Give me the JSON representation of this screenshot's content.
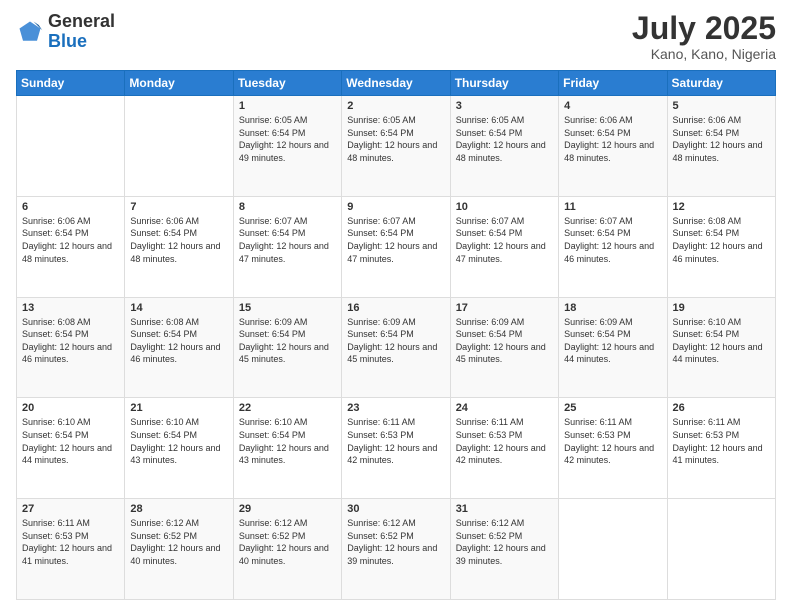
{
  "header": {
    "logo_general": "General",
    "logo_blue": "Blue",
    "month": "July 2025",
    "location": "Kano, Kano, Nigeria"
  },
  "weekdays": [
    "Sunday",
    "Monday",
    "Tuesday",
    "Wednesday",
    "Thursday",
    "Friday",
    "Saturday"
  ],
  "weeks": [
    [
      {
        "day": "",
        "sunrise": "",
        "sunset": "",
        "daylight": ""
      },
      {
        "day": "",
        "sunrise": "",
        "sunset": "",
        "daylight": ""
      },
      {
        "day": "1",
        "sunrise": "Sunrise: 6:05 AM",
        "sunset": "Sunset: 6:54 PM",
        "daylight": "Daylight: 12 hours and 49 minutes."
      },
      {
        "day": "2",
        "sunrise": "Sunrise: 6:05 AM",
        "sunset": "Sunset: 6:54 PM",
        "daylight": "Daylight: 12 hours and 48 minutes."
      },
      {
        "day": "3",
        "sunrise": "Sunrise: 6:05 AM",
        "sunset": "Sunset: 6:54 PM",
        "daylight": "Daylight: 12 hours and 48 minutes."
      },
      {
        "day": "4",
        "sunrise": "Sunrise: 6:06 AM",
        "sunset": "Sunset: 6:54 PM",
        "daylight": "Daylight: 12 hours and 48 minutes."
      },
      {
        "day": "5",
        "sunrise": "Sunrise: 6:06 AM",
        "sunset": "Sunset: 6:54 PM",
        "daylight": "Daylight: 12 hours and 48 minutes."
      }
    ],
    [
      {
        "day": "6",
        "sunrise": "Sunrise: 6:06 AM",
        "sunset": "Sunset: 6:54 PM",
        "daylight": "Daylight: 12 hours and 48 minutes."
      },
      {
        "day": "7",
        "sunrise": "Sunrise: 6:06 AM",
        "sunset": "Sunset: 6:54 PM",
        "daylight": "Daylight: 12 hours and 48 minutes."
      },
      {
        "day": "8",
        "sunrise": "Sunrise: 6:07 AM",
        "sunset": "Sunset: 6:54 PM",
        "daylight": "Daylight: 12 hours and 47 minutes."
      },
      {
        "day": "9",
        "sunrise": "Sunrise: 6:07 AM",
        "sunset": "Sunset: 6:54 PM",
        "daylight": "Daylight: 12 hours and 47 minutes."
      },
      {
        "day": "10",
        "sunrise": "Sunrise: 6:07 AM",
        "sunset": "Sunset: 6:54 PM",
        "daylight": "Daylight: 12 hours and 47 minutes."
      },
      {
        "day": "11",
        "sunrise": "Sunrise: 6:07 AM",
        "sunset": "Sunset: 6:54 PM",
        "daylight": "Daylight: 12 hours and 46 minutes."
      },
      {
        "day": "12",
        "sunrise": "Sunrise: 6:08 AM",
        "sunset": "Sunset: 6:54 PM",
        "daylight": "Daylight: 12 hours and 46 minutes."
      }
    ],
    [
      {
        "day": "13",
        "sunrise": "Sunrise: 6:08 AM",
        "sunset": "Sunset: 6:54 PM",
        "daylight": "Daylight: 12 hours and 46 minutes."
      },
      {
        "day": "14",
        "sunrise": "Sunrise: 6:08 AM",
        "sunset": "Sunset: 6:54 PM",
        "daylight": "Daylight: 12 hours and 46 minutes."
      },
      {
        "day": "15",
        "sunrise": "Sunrise: 6:09 AM",
        "sunset": "Sunset: 6:54 PM",
        "daylight": "Daylight: 12 hours and 45 minutes."
      },
      {
        "day": "16",
        "sunrise": "Sunrise: 6:09 AM",
        "sunset": "Sunset: 6:54 PM",
        "daylight": "Daylight: 12 hours and 45 minutes."
      },
      {
        "day": "17",
        "sunrise": "Sunrise: 6:09 AM",
        "sunset": "Sunset: 6:54 PM",
        "daylight": "Daylight: 12 hours and 45 minutes."
      },
      {
        "day": "18",
        "sunrise": "Sunrise: 6:09 AM",
        "sunset": "Sunset: 6:54 PM",
        "daylight": "Daylight: 12 hours and 44 minutes."
      },
      {
        "day": "19",
        "sunrise": "Sunrise: 6:10 AM",
        "sunset": "Sunset: 6:54 PM",
        "daylight": "Daylight: 12 hours and 44 minutes."
      }
    ],
    [
      {
        "day": "20",
        "sunrise": "Sunrise: 6:10 AM",
        "sunset": "Sunset: 6:54 PM",
        "daylight": "Daylight: 12 hours and 44 minutes."
      },
      {
        "day": "21",
        "sunrise": "Sunrise: 6:10 AM",
        "sunset": "Sunset: 6:54 PM",
        "daylight": "Daylight: 12 hours and 43 minutes."
      },
      {
        "day": "22",
        "sunrise": "Sunrise: 6:10 AM",
        "sunset": "Sunset: 6:54 PM",
        "daylight": "Daylight: 12 hours and 43 minutes."
      },
      {
        "day": "23",
        "sunrise": "Sunrise: 6:11 AM",
        "sunset": "Sunset: 6:53 PM",
        "daylight": "Daylight: 12 hours and 42 minutes."
      },
      {
        "day": "24",
        "sunrise": "Sunrise: 6:11 AM",
        "sunset": "Sunset: 6:53 PM",
        "daylight": "Daylight: 12 hours and 42 minutes."
      },
      {
        "day": "25",
        "sunrise": "Sunrise: 6:11 AM",
        "sunset": "Sunset: 6:53 PM",
        "daylight": "Daylight: 12 hours and 42 minutes."
      },
      {
        "day": "26",
        "sunrise": "Sunrise: 6:11 AM",
        "sunset": "Sunset: 6:53 PM",
        "daylight": "Daylight: 12 hours and 41 minutes."
      }
    ],
    [
      {
        "day": "27",
        "sunrise": "Sunrise: 6:11 AM",
        "sunset": "Sunset: 6:53 PM",
        "daylight": "Daylight: 12 hours and 41 minutes."
      },
      {
        "day": "28",
        "sunrise": "Sunrise: 6:12 AM",
        "sunset": "Sunset: 6:52 PM",
        "daylight": "Daylight: 12 hours and 40 minutes."
      },
      {
        "day": "29",
        "sunrise": "Sunrise: 6:12 AM",
        "sunset": "Sunset: 6:52 PM",
        "daylight": "Daylight: 12 hours and 40 minutes."
      },
      {
        "day": "30",
        "sunrise": "Sunrise: 6:12 AM",
        "sunset": "Sunset: 6:52 PM",
        "daylight": "Daylight: 12 hours and 39 minutes."
      },
      {
        "day": "31",
        "sunrise": "Sunrise: 6:12 AM",
        "sunset": "Sunset: 6:52 PM",
        "daylight": "Daylight: 12 hours and 39 minutes."
      },
      {
        "day": "",
        "sunrise": "",
        "sunset": "",
        "daylight": ""
      },
      {
        "day": "",
        "sunrise": "",
        "sunset": "",
        "daylight": ""
      }
    ]
  ]
}
